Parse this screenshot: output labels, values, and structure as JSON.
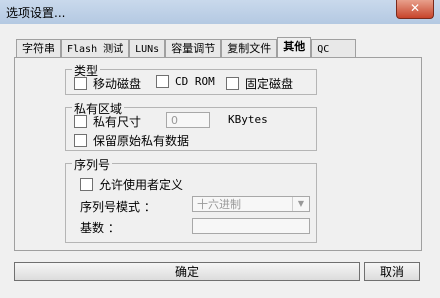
{
  "window": {
    "title": "选项设置...",
    "close_label": "✕"
  },
  "tabs": [
    {
      "label": "字符串"
    },
    {
      "label": "Flash 测试"
    },
    {
      "label": "LUNs"
    },
    {
      "label": "容量调节"
    },
    {
      "label": "复制文件"
    },
    {
      "label": "其他"
    },
    {
      "label": "QC"
    }
  ],
  "type_group": {
    "label": "类型",
    "options": [
      {
        "label": "移动磁盘",
        "checked": false
      },
      {
        "label": "CD ROM",
        "checked": false
      },
      {
        "label": "固定磁盘",
        "checked": false
      }
    ]
  },
  "private_group": {
    "label": "私有区域",
    "size_label": "私有尺寸",
    "size_value": "0",
    "unit": "KBytes",
    "keep_label": "保留原始私有数据"
  },
  "serial_group": {
    "label": "序列号",
    "allow_label": "允许使用者定义",
    "mode_label": "序列号模式 ：",
    "mode_value": "十六进制",
    "base_label": "基数 ："
  },
  "buttons": {
    "ok": "确定",
    "cancel": "取消"
  }
}
